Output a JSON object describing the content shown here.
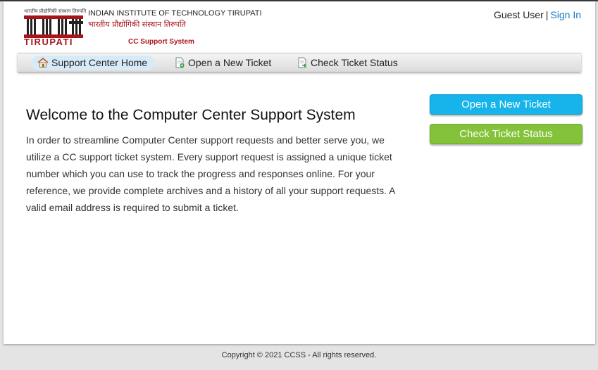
{
  "header": {
    "logo_hindi_small": "भारतीय प्रौद्योगिकी संस्थान तिरुपति",
    "logo_iit_text": "TIRUPATI",
    "institute_name": "INDIAN INSTITUTE OF TECHNOLOGY TIRUPATI",
    "institute_hindi": "भारतीय प्रौद्योगिकी संस्थान तिरुपति",
    "system_name": "CC Support System"
  },
  "user": {
    "guest_label": "Guest User",
    "separator": "|",
    "signin_label": "Sign In"
  },
  "nav": {
    "items": [
      {
        "label": "Support Center Home",
        "icon": "home-icon"
      },
      {
        "label": "Open a New Ticket",
        "icon": "new-ticket-icon"
      },
      {
        "label": "Check Ticket Status",
        "icon": "ticket-status-icon"
      }
    ]
  },
  "main": {
    "title": "Welcome to the Computer Center Support System",
    "intro": "In order to streamline Computer Center support requests and better serve you, we utilize a CC support ticket system. Every support request is assigned a unique ticket number which you can use to track the progress and responses online. For your reference, we provide complete archives and a history of all your support requests. A valid email address is required to submit a ticket."
  },
  "sidebar": {
    "open_ticket_label": "Open a New Ticket",
    "check_status_label": "Check Ticket Status"
  },
  "footer": {
    "copyright": "Copyright © 2021 CCSS - All rights reserved."
  },
  "colors": {
    "brand_red": "#a8141c",
    "link_blue": "#1a78c2",
    "open_button": "#16b4ea",
    "check_button": "#84c23a"
  }
}
